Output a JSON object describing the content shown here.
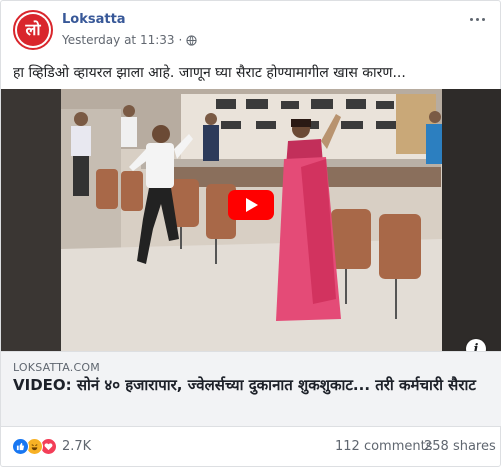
{
  "post": {
    "page_name": "Loksatta",
    "avatar_text": "लो",
    "timestamp": "Yesterday at 11:33",
    "dot_separator": "·",
    "text": "हा व्हिडिओ व्हायरल झाला आहे. जाणून घ्या सैराट होण्यामागील खास कारण..."
  },
  "link_preview": {
    "domain": "LOKSATTA.COM",
    "headline": "VIDEO: सोनं ४० हजारापार, ज्वेलर्सच्या दुकानात शुकशुकाट... तरी कर्मचारी सैराट"
  },
  "footer": {
    "reaction_count": "2.7K",
    "comments": "112 comments",
    "shares": "258 shares"
  },
  "icons": {
    "globe": "globe-icon",
    "more": "more-options-icon",
    "play": "play-icon",
    "info": "info-icon",
    "reactions": [
      "like-icon",
      "haha-icon",
      "love-icon"
    ]
  },
  "colors": {
    "link_blue": "#385898",
    "play_red": "#ff0000",
    "like_blue": "#1877f2",
    "love_red": "#f33e58",
    "haha_yellow": "#f7b125"
  }
}
